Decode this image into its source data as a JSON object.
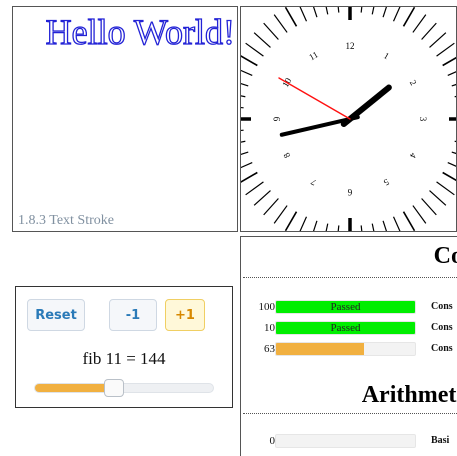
{
  "hello": {
    "title": "Hello World!",
    "caption": "1.8.3 Text Stroke",
    "stroke_color": "#2323d6"
  },
  "clock": {
    "hour_labels": [
      "12",
      "1",
      "2",
      "3",
      "4",
      "5",
      "6",
      "7",
      "8",
      "9",
      "10",
      "11"
    ],
    "hour": 1,
    "minute": 42,
    "second": 50
  },
  "counter": {
    "reset_label": "Reset",
    "minus_label": "-1",
    "plus_label": "+1",
    "fib_text": "fib 11 = 144",
    "slider_value": 0.44
  },
  "tests": {
    "section1_title": "Co",
    "section2_title": "Arithmeti",
    "rows": [
      {
        "num": "100",
        "label": "Passed",
        "name": "Cons",
        "progress": 1.0,
        "color": "#00ee00"
      },
      {
        "num": "10",
        "label": "Passed",
        "name": "Cons",
        "progress": 1.0,
        "color": "#00ee00"
      },
      {
        "num": "63",
        "label": "",
        "name": "Cons",
        "progress": 0.63,
        "color": "#f1b040"
      },
      {
        "num": "0",
        "label": "",
        "name": "Basi",
        "progress": 0.0,
        "color": "#f1b040"
      }
    ]
  }
}
